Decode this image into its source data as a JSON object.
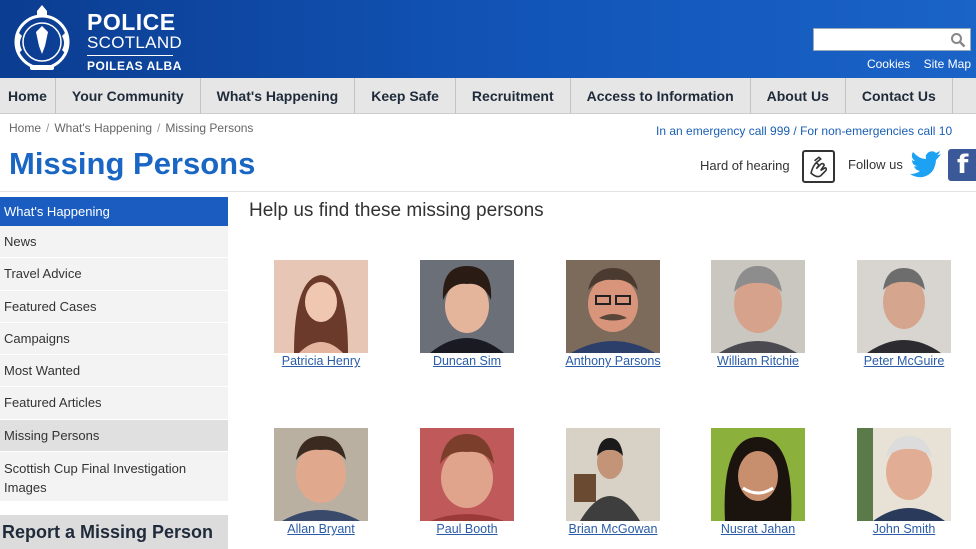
{
  "header": {
    "brand_line1": "POLICE",
    "brand_line2": "SCOTLAND",
    "brand_line3": "POILEAS ALBA",
    "search_placeholder": "",
    "links": [
      "Cookies",
      "Site Map"
    ]
  },
  "nav": [
    "Home",
    "Your Community",
    "What's Happening",
    "Keep Safe",
    "Recruitment",
    "Access to Information",
    "About Us",
    "Contact Us"
  ],
  "breadcrumb": [
    "Home",
    "What's Happening",
    "Missing Persons"
  ],
  "emergency_text": "In an emergency call 999 / For non-emergencies call 10",
  "page_title": "Missing Persons",
  "hard_of_hearing": "Hard of hearing",
  "follow_us": "Follow us",
  "sidebar": {
    "header": "What's Happening",
    "items": [
      "News",
      "Travel Advice",
      "Featured Cases",
      "Campaigns",
      "Most Wanted",
      "Featured Articles",
      "Missing Persons",
      "Scottish Cup Final Investigation Images"
    ],
    "report": "Report a Missing Person"
  },
  "main": {
    "heading": "Help us find these missing persons",
    "people": [
      {
        "name": "Patricia Henry"
      },
      {
        "name": "Duncan Sim"
      },
      {
        "name": "Anthony Parsons"
      },
      {
        "name": "William Ritchie"
      },
      {
        "name": "Peter McGuire"
      },
      {
        "name": "Allan Bryant"
      },
      {
        "name": "Paul Booth"
      },
      {
        "name": "Brian McGowan"
      },
      {
        "name": "Nusrat Jahan"
      },
      {
        "name": "John Smith"
      }
    ]
  },
  "colors": {
    "header_blue": "#0b3d91",
    "accent": "#1a66c4",
    "link": "#2a5ca8"
  }
}
